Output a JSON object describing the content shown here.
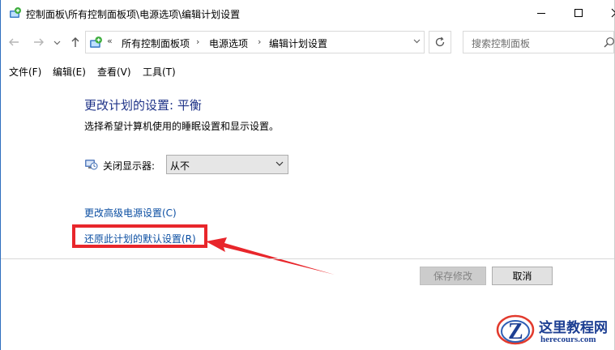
{
  "window": {
    "title": "控制面板\\所有控制面板项\\电源选项\\编辑计划设置",
    "icon": "control-panel-icon"
  },
  "address": {
    "crumbs": [
      "所有控制面板项",
      "电源选项",
      "编辑计划设置"
    ],
    "prefix": "«",
    "search_placeholder": "搜索控制面板"
  },
  "menu": {
    "items": [
      "文件(F)",
      "编辑(E)",
      "查看(V)",
      "工具(T)"
    ]
  },
  "content": {
    "heading": "更改计划的设置: 平衡",
    "subtext": "选择希望计算机使用的睡眠设置和显示设置。",
    "display_label": "关闭显示器:",
    "display_value": "从不",
    "link_advanced": "更改高级电源设置(C)",
    "link_restore": "还原此计划的默认设置(R)"
  },
  "buttons": {
    "save": "保存修改",
    "cancel": "取消"
  },
  "watermark": {
    "title": "这里教程网",
    "url": "herecours.com"
  },
  "colors": {
    "accent": "#1e3287",
    "link": "#0b4ea2",
    "annotation": "#e8262b"
  }
}
